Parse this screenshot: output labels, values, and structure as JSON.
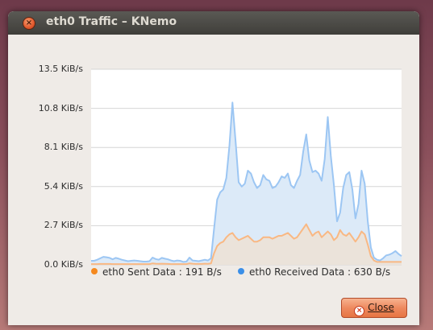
{
  "window": {
    "title": "eth0 Traffic – KNemo",
    "close_glyph": "×"
  },
  "chart_data": {
    "type": "area",
    "ylim": [
      0,
      13.5
    ],
    "yticks": [
      {
        "value": 13.5,
        "label": "13.5 KiB/s"
      },
      {
        "value": 10.8,
        "label": "10.8 KiB/s"
      },
      {
        "value": 8.1,
        "label": "8.1 KiB/s"
      },
      {
        "value": 5.4,
        "label": "5.4 KiB/s"
      },
      {
        "value": 2.7,
        "label": "2.7 KiB/s"
      },
      {
        "value": 0.0,
        "label": "0.0 KiB/s"
      }
    ],
    "grid": true,
    "legend_placement": "bottom",
    "series": [
      {
        "name": "eth0 Received Data",
        "color": "#3b8fe8",
        "line_color": "#9cc6f3",
        "fill_color": "#dceaf8",
        "values": [
          0.28,
          0.28,
          0.35,
          0.45,
          0.55,
          0.52,
          0.48,
          0.38,
          0.48,
          0.42,
          0.35,
          0.3,
          0.25,
          0.28,
          0.3,
          0.28,
          0.25,
          0.22,
          0.22,
          0.25,
          0.5,
          0.4,
          0.35,
          0.48,
          0.42,
          0.38,
          0.3,
          0.25,
          0.3,
          0.28,
          0.2,
          0.22,
          0.5,
          0.3,
          0.28,
          0.25,
          0.3,
          0.35,
          0.3,
          0.45,
          2.5,
          4.5,
          5.0,
          5.2,
          6.0,
          8.2,
          11.2,
          8.5,
          5.7,
          5.4,
          5.6,
          6.5,
          6.3,
          5.7,
          5.3,
          5.5,
          6.2,
          5.9,
          5.8,
          5.3,
          5.4,
          5.7,
          6.1,
          6.0,
          6.3,
          5.5,
          5.3,
          5.8,
          6.2,
          7.8,
          9.0,
          7.2,
          6.4,
          6.5,
          6.3,
          5.8,
          7.3,
          10.2,
          7.5,
          5.5,
          3.0,
          3.6,
          5.3,
          6.2,
          6.4,
          5.2,
          3.2,
          4.2,
          6.5,
          5.6,
          3.0,
          1.2,
          0.5,
          0.35,
          0.3,
          0.45,
          0.65,
          0.7,
          0.8,
          0.95,
          0.75,
          0.6
        ]
      },
      {
        "name": "eth0 Sent Data",
        "color": "#f5891f",
        "line_color": "#f9b883",
        "fill_color": "#ebe3da",
        "values": [
          0.05,
          0.05,
          0.05,
          0.06,
          0.06,
          0.06,
          0.06,
          0.05,
          0.05,
          0.05,
          0.05,
          0.05,
          0.05,
          0.05,
          0.05,
          0.05,
          0.05,
          0.05,
          0.05,
          0.05,
          0.1,
          0.08,
          0.07,
          0.08,
          0.07,
          0.06,
          0.05,
          0.05,
          0.05,
          0.05,
          0.05,
          0.05,
          0.1,
          0.08,
          0.06,
          0.06,
          0.06,
          0.08,
          0.07,
          0.1,
          0.8,
          1.3,
          1.5,
          1.6,
          1.9,
          2.1,
          2.2,
          1.9,
          1.7,
          1.8,
          1.9,
          2.0,
          1.8,
          1.6,
          1.6,
          1.7,
          1.9,
          1.9,
          1.9,
          1.8,
          1.9,
          2.0,
          2.0,
          2.1,
          2.2,
          2.0,
          1.8,
          1.9,
          2.2,
          2.5,
          2.8,
          2.4,
          2.0,
          2.2,
          2.3,
          1.9,
          2.1,
          2.3,
          2.1,
          1.7,
          1.9,
          2.4,
          2.1,
          2.0,
          2.2,
          1.9,
          1.6,
          1.9,
          2.3,
          2.1,
          1.4,
          0.6,
          0.3,
          0.2,
          0.2,
          0.2,
          0.2,
          0.2,
          0.2,
          0.2,
          0.2,
          0.2
        ]
      }
    ]
  },
  "legend": {
    "sent_label": "eth0 Sent Data :  191 B/s",
    "received_label": "eth0 Received Data :  630 B/s"
  },
  "buttons": {
    "close_label": "Close",
    "close_icon_glyph": "×"
  }
}
